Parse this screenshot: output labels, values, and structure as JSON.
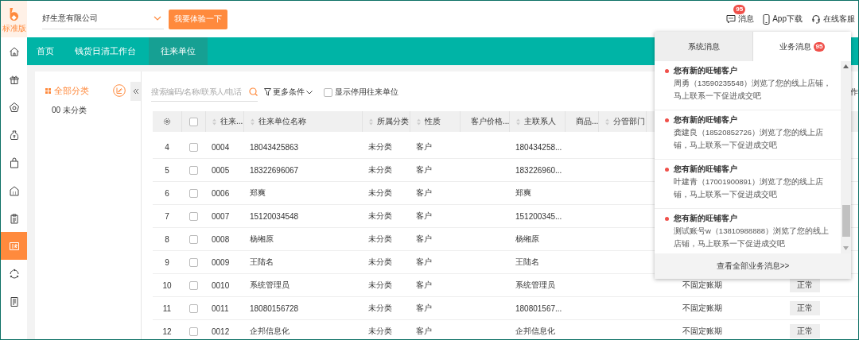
{
  "logo": {
    "edition": "标准版"
  },
  "header": {
    "company": "好生意有限公司",
    "trial_button": "我要体验一下",
    "actions": [
      {
        "kind": "message",
        "label": "消息",
        "badge": "95"
      },
      {
        "kind": "phone",
        "label": "App下载"
      },
      {
        "kind": "headset",
        "label": "在线客服"
      }
    ]
  },
  "rail": [
    {
      "kind": "home",
      "selected": false
    },
    {
      "kind": "gift",
      "selected": false
    },
    {
      "kind": "coin-house",
      "selected": false
    },
    {
      "kind": "money-bag",
      "selected": false
    },
    {
      "kind": "bag",
      "selected": false
    },
    {
      "kind": "building",
      "selected": false
    },
    {
      "kind": "clipboard",
      "selected": false
    },
    {
      "kind": "card",
      "selected": true
    },
    {
      "kind": "cycle",
      "selected": false
    },
    {
      "kind": "document",
      "selected": false
    }
  ],
  "nav_tabs": [
    {
      "label": "首页",
      "selected": false
    },
    {
      "label": "钱货日清工作台",
      "selected": false
    },
    {
      "label": "往来单位",
      "selected": true
    }
  ],
  "categories": {
    "title": "全部分类",
    "items": [
      "00 未分类"
    ]
  },
  "toolbar": {
    "search_placeholder": "搜索编码/名称/联系人/电话",
    "more_filter": "更多条件",
    "show_disabled": {
      "label": "显示停用往来单位",
      "checked": false
    },
    "cut_label": "作"
  },
  "table": {
    "select_all_checked": false,
    "columns": [
      "往来...",
      "往来单位名称",
      "所属分类",
      "性质",
      "客户价格...",
      "主联系人",
      "商品...",
      "分管部门"
    ],
    "rows": [
      {
        "index": "4",
        "checked": false,
        "code": "0004",
        "name": "18043425863",
        "category": "未分类",
        "nature": "客户",
        "contact": "180434258..."
      },
      {
        "index": "5",
        "checked": false,
        "code": "0005",
        "name": "18322696067",
        "category": "未分类",
        "nature": "客户",
        "contact": "183226960..."
      },
      {
        "index": "6",
        "checked": false,
        "code": "0006",
        "name": "郑爽",
        "category": "未分类",
        "nature": "客户",
        "contact": "郑爽"
      },
      {
        "index": "7",
        "checked": false,
        "code": "0007",
        "name": "15120034548",
        "category": "未分类",
        "nature": "客户",
        "contact": "151200345..."
      },
      {
        "index": "8",
        "checked": false,
        "code": "0008",
        "name": "杨缃原",
        "category": "未分类",
        "nature": "客户",
        "contact": "杨缃原"
      },
      {
        "index": "9",
        "checked": false,
        "code": "0009",
        "name": "王陆名",
        "category": "未分类",
        "nature": "客户",
        "contact": "王陆名"
      },
      {
        "index": "10",
        "checked": false,
        "code": "0010",
        "name": "系统管理员",
        "category": "未分类",
        "nature": "客户",
        "contact": "系统管理员",
        "payment_term": "不固定账期",
        "status": "正常"
      },
      {
        "index": "11",
        "checked": false,
        "code": "0011",
        "name": "18080156728",
        "category": "未分类",
        "nature": "客户",
        "contact": "180801567...",
        "payment_term": "不固定账期",
        "status": "正常"
      },
      {
        "index": "12",
        "checked": false,
        "code": "0012",
        "name": "企邦信息化",
        "category": "未分类",
        "nature": "客户",
        "contact": "企邦信息化",
        "payment_term": "不固定账期",
        "status": "正常"
      }
    ]
  },
  "popup": {
    "tabs": [
      {
        "label": "系统消息",
        "selected": false
      },
      {
        "label": "业务消息",
        "badge": "95",
        "selected": true
      }
    ],
    "messages": [
      {
        "title": "您有新的旺铺客户",
        "body": "周勇（13590235548）浏览了您的线上店铺，马上联系一下促进成交吧",
        "unread": true
      },
      {
        "title": "您有新的旺铺客户",
        "body": "龚建良（18520852726）浏览了您的线上店铺，马上联系一下促进成交吧",
        "unread": true
      },
      {
        "title": "您有新的旺铺客户",
        "body": "叶建青（17001900891）浏览了您的线上店铺，马上联系一下促进成交吧",
        "unread": true
      },
      {
        "title": "您有新的旺铺客户",
        "body": "测试账号w（13810988888）浏览了您的线上店铺，马上联系一下促进成交吧",
        "unread": true
      }
    ],
    "footer": "查看全部业务消息>>"
  }
}
